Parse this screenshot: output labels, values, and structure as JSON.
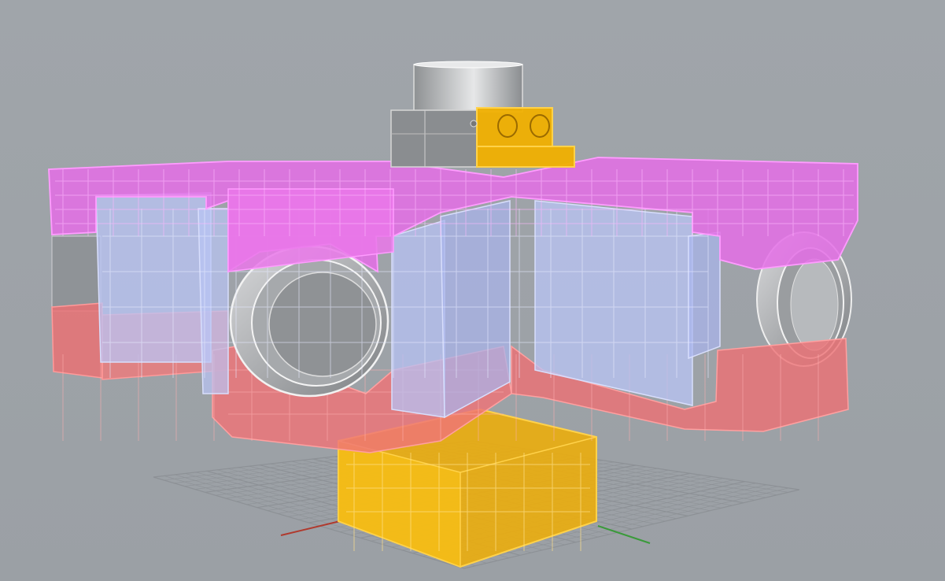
{
  "viewport": {
    "projection": "perspective",
    "display_mode": "ghosted"
  },
  "colors": {
    "background": "#9ea3a8",
    "grid_line": "#8d9196",
    "axis_x": "#b03a2e",
    "axis_y": "#3a9a3a",
    "layer_magenta": "#e86fe8",
    "layer_blue": "#b4bff2",
    "layer_red": "#f0747a",
    "layer_yellow": "#f2b400",
    "cylinder_gray": "#c9cbcd"
  },
  "layers": [
    {
      "name": "magenta",
      "color": "#e86fe8"
    },
    {
      "name": "blue",
      "color": "#b4bff2"
    },
    {
      "name": "red",
      "color": "#f0747a"
    },
    {
      "name": "yellow",
      "color": "#f2b400"
    },
    {
      "name": "gray",
      "color": "#c9cbcd"
    }
  ]
}
